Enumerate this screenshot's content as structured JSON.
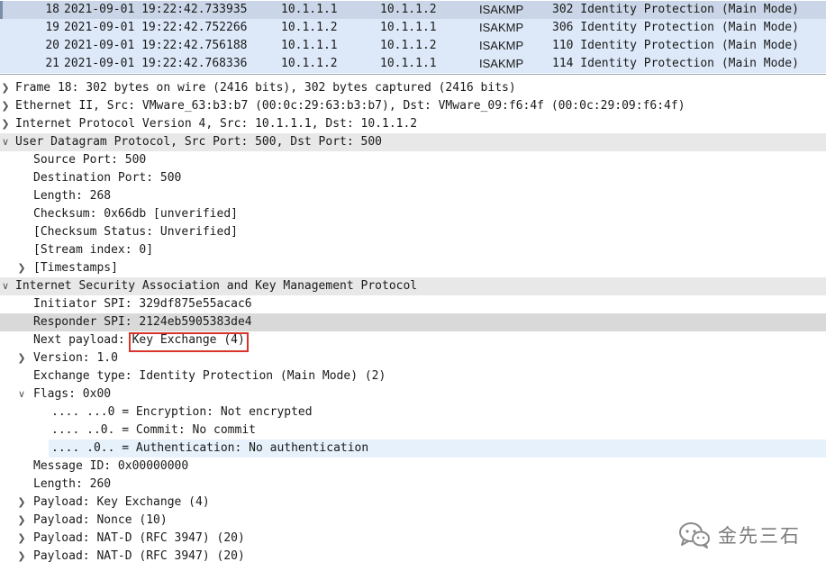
{
  "packet_list": {
    "rows": [
      {
        "no": "18",
        "time": "2021-09-01 19:22:42.733935",
        "src": "10.1.1.1",
        "dst": "10.1.1.2",
        "proto": "ISAKMP",
        "info": "302 Identity Protection (Main Mode)"
      },
      {
        "no": "19",
        "time": "2021-09-01 19:22:42.752266",
        "src": "10.1.1.2",
        "dst": "10.1.1.1",
        "proto": "ISAKMP",
        "info": "306 Identity Protection (Main Mode)"
      },
      {
        "no": "20",
        "time": "2021-09-01 19:22:42.756188",
        "src": "10.1.1.1",
        "dst": "10.1.1.2",
        "proto": "ISAKMP",
        "info": "110 Identity Protection (Main Mode)"
      },
      {
        "no": "21",
        "time": "2021-09-01 19:22:42.768336",
        "src": "10.1.1.2",
        "dst": "10.1.1.1",
        "proto": "ISAKMP",
        "info": "114 Identity Protection (Main Mode)"
      }
    ]
  },
  "details": {
    "frame": "Frame 18: 302 bytes on wire (2416 bits), 302 bytes captured (2416 bits)",
    "ethernet": "Ethernet II, Src: VMware_63:b3:b7 (00:0c:29:63:b3:b7), Dst: VMware_09:f6:4f (00:0c:29:09:f6:4f)",
    "ip": "Internet Protocol Version 4, Src: 10.1.1.1, Dst: 10.1.1.2",
    "udp": {
      "header": "User Datagram Protocol, Src Port: 500, Dst Port: 500",
      "src_port": "Source Port: 500",
      "dst_port": "Destination Port: 500",
      "length": "Length: 268",
      "checksum": "Checksum: 0x66db [unverified]",
      "checksum_status": "[Checksum Status: Unverified]",
      "stream_index": "[Stream index: 0]",
      "timestamps": "[Timestamps]"
    },
    "isakmp": {
      "header": "Internet Security Association and Key Management Protocol",
      "initiator_spi": "Initiator SPI: 329df875e55acac6",
      "responder_spi": "Responder SPI: 2124eb5905383de4",
      "next_payload_label": "Next payload: ",
      "next_payload_value": "Key Exchange (4)",
      "version": "Version: 1.0",
      "exchange_type": "Exchange type: Identity Protection (Main Mode) (2)",
      "flags": "Flags: 0x00",
      "flag_encryption": ".... ...0 = Encryption: Not encrypted",
      "flag_commit": ".... ..0. = Commit: No commit",
      "flag_auth": ".... .0.. = Authentication: No authentication",
      "message_id": "Message ID: 0x00000000",
      "length": "Length: 260",
      "payload_ke": "Payload: Key Exchange (4)",
      "payload_nonce": "Payload: Nonce (10)",
      "payload_natd_1": "Payload: NAT-D (RFC 3947) (20)",
      "payload_natd_2": "Payload: NAT-D (RFC 3947) (20)"
    }
  },
  "watermark": {
    "text": "金先三石",
    "icon": "wechat-icon"
  }
}
